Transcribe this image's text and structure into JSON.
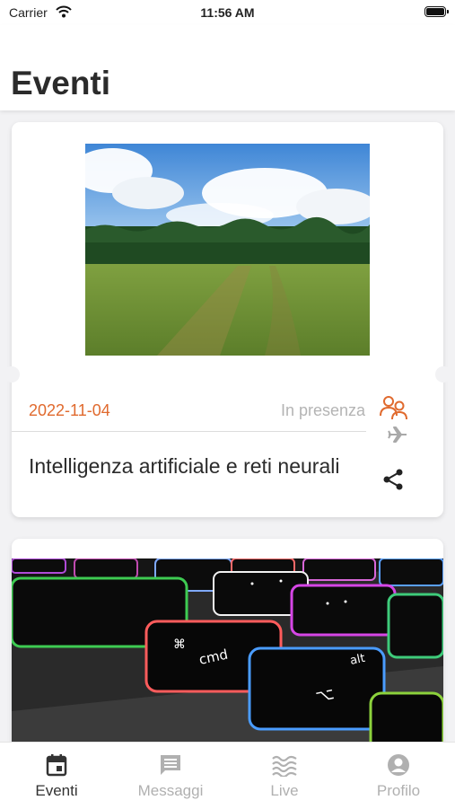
{
  "status_bar": {
    "carrier": "Carrier",
    "time": "11:56 AM"
  },
  "header": {
    "title": "Eventi"
  },
  "events": [
    {
      "date": "2022-11-04",
      "modality": "In presenza",
      "title": "Intelligenza artificiale e reti neurali",
      "image_icon": "landscape-photo",
      "icons": [
        "people-icon",
        "plane-icon",
        "share-icon"
      ]
    },
    {
      "image_icon": "keyboard-photo"
    }
  ],
  "colors": {
    "accent": "#e06a2e",
    "muted": "#b4b4b4",
    "text": "#2b2b2b",
    "inactive_tab": "#b0b0b0"
  },
  "tabbar": {
    "tabs": [
      {
        "label": "Eventi",
        "icon": "calendar-icon",
        "active": true
      },
      {
        "label": "Messaggi",
        "icon": "chat-icon",
        "active": false
      },
      {
        "label": "Live",
        "icon": "waves-icon",
        "active": false
      },
      {
        "label": "Profilo",
        "icon": "person-icon",
        "active": false
      }
    ]
  }
}
